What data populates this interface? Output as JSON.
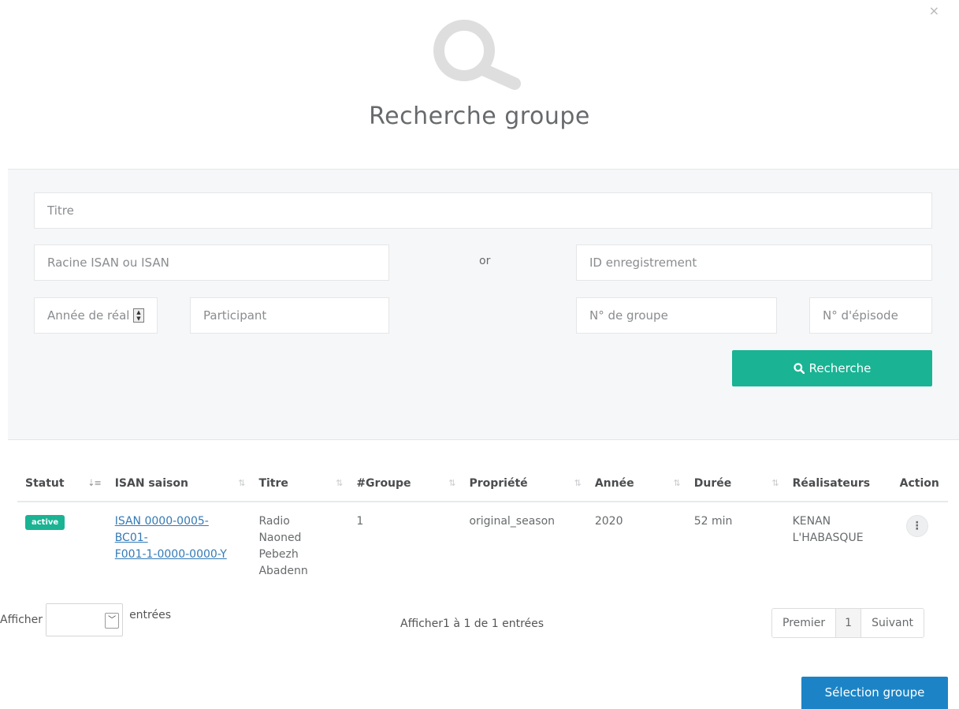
{
  "modal": {
    "close_symbol": "×",
    "title": "Recherche groupe",
    "header_icon": "search-icon"
  },
  "search": {
    "titre_placeholder": "Titre",
    "isan_placeholder": "Racine ISAN ou ISAN",
    "or_label": "or",
    "id_enregistrement_placeholder": "ID enregistrement",
    "annee_placeholder": "Année de réalisation",
    "participant_placeholder": "Participant",
    "groupe_placeholder": "N° de groupe",
    "episode_placeholder": "N° d'épisode",
    "button_label": "Recherche"
  },
  "table": {
    "headers": [
      "Statut",
      "ISAN saison",
      "Titre",
      "#Groupe",
      "Propriété",
      "Année",
      "Durée",
      "Réalisateurs",
      "Action"
    ],
    "rows": [
      {
        "statut": "active",
        "isan_line1": "ISAN 0000-0005-",
        "isan_line2": "BC01-",
        "isan_line3": "F001-1-0000-0000-Y",
        "titre_line1": "Radio",
        "titre_line2": "Naoned",
        "titre_line3": "Pebezh",
        "titre_line4": "Abadenn",
        "groupe": "1",
        "propriete": "original_season",
        "annee": "2020",
        "duree": "52 min",
        "realisateurs_line1": "KENAN",
        "realisateurs_line2": "L'HABASQUE",
        "action_symbol": "⋮"
      }
    ]
  },
  "footer": {
    "afficher_label": "Afficher",
    "entrees_label": "entrées",
    "info": "Afficher1 à 1 de 1 entrées",
    "pagination": {
      "first": "Premier",
      "current": "1",
      "next": "Suivant"
    },
    "select_button": "Sélection groupe"
  },
  "colors": {
    "accent_green": "#1ab394",
    "accent_blue": "#1c84c6",
    "link_blue": "#337ab7"
  }
}
